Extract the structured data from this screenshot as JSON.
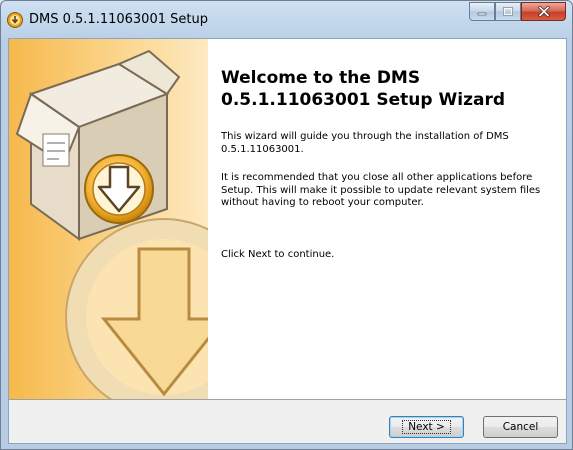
{
  "window": {
    "title": "DMS 0.5.1.11063001 Setup",
    "icon": "installer-icon",
    "caption_buttons": [
      "minimize-icon",
      "maximize-icon",
      "close-icon"
    ]
  },
  "wizard": {
    "heading": "Welcome to the DMS\n0.5.1.11063001 Setup Wizard",
    "paragraph1": "This wizard will guide you through the installation of DMS 0.5.1.11063001.",
    "paragraph2": "It is recommended that you close all other applications before Setup. This will make it possible to update relevant system files without having to reboot your computer.",
    "paragraph3": "Click Next to continue.",
    "banner_graphic": "box-with-download-arrow"
  },
  "buttons": {
    "next_label": "Next >",
    "cancel_label": "Cancel"
  },
  "colors": {
    "banner_orange": "#f6b94c",
    "banner_light": "#fde6b4"
  }
}
